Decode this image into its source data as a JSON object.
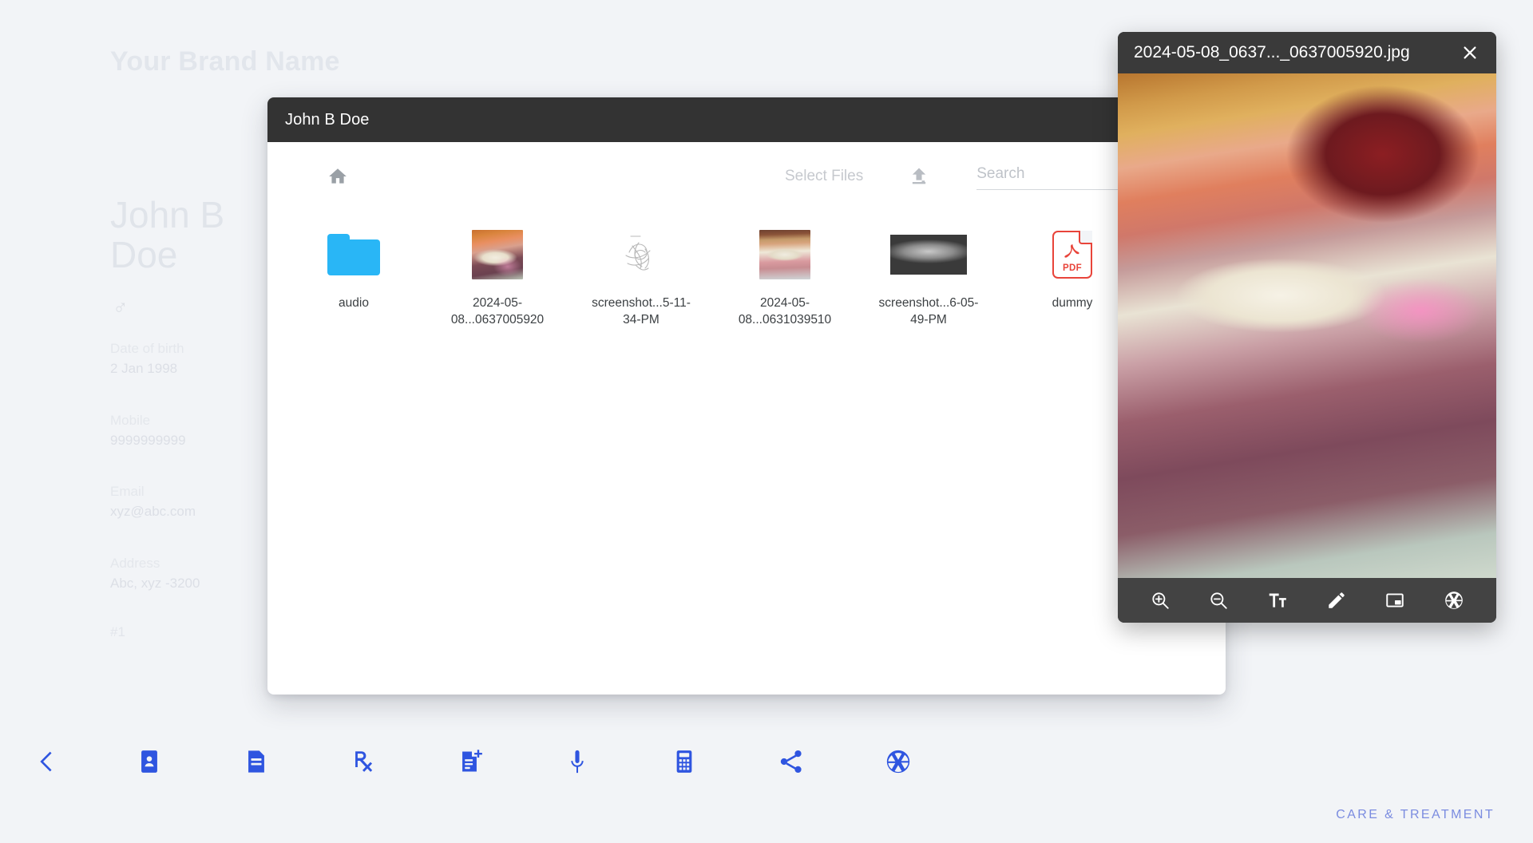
{
  "brand": {
    "name": "Your Brand Name"
  },
  "patient": {
    "name": "John B Doe",
    "gender_icon": "male-symbol",
    "gender_glyph": "♂",
    "dob_label": "Date of birth",
    "dob_value": "2 Jan 1998",
    "mobile_label": "Mobile",
    "mobile_value": "9999999999",
    "email_label": "Email",
    "email_value": "xyz@abc.com",
    "address_label": "Address",
    "address_value": "Abc, xyz -3200",
    "serial": "#1"
  },
  "file_manager": {
    "title": "John B Doe",
    "home_icon": "home-icon",
    "select_files_label": "Select Files",
    "upload_icon": "upload-icon",
    "search": {
      "placeholder": "Search",
      "value": ""
    },
    "files": [
      {
        "name": "audio",
        "type": "folder",
        "icon": "folder-icon"
      },
      {
        "name": "2024-05-08...0637005920",
        "type": "image",
        "icon": "photo-thumbnail"
      },
      {
        "name": "screenshot...5-11-34-PM",
        "type": "image",
        "icon": "sketch-thumbnail"
      },
      {
        "name": "2024-05-08...0631039510",
        "type": "image",
        "icon": "photo-thumbnail"
      },
      {
        "name": "screenshot...6-05-49-PM",
        "type": "image",
        "icon": "xray-thumbnail"
      },
      {
        "name": "dummy",
        "type": "pdf",
        "icon": "pdf-icon",
        "badge": "PDF"
      }
    ]
  },
  "viewer": {
    "title": "2024-05-08_0637..._0637005920.jpg",
    "close_icon": "close-icon",
    "toolbar": [
      {
        "name": "zoom-in-icon",
        "label": "Zoom in"
      },
      {
        "name": "zoom-out-icon",
        "label": "Zoom out"
      },
      {
        "name": "text-format-icon",
        "label": "Text"
      },
      {
        "name": "pencil-icon",
        "label": "Draw"
      },
      {
        "name": "picture-in-picture-icon",
        "label": "Picture in picture"
      },
      {
        "name": "aperture-icon",
        "label": "Camera"
      }
    ]
  },
  "bottom_nav": [
    {
      "name": "back-chevron-icon",
      "label": "Back"
    },
    {
      "name": "contact-folder-icon",
      "label": "Patient profile"
    },
    {
      "name": "notes-folder-icon",
      "label": "Records"
    },
    {
      "name": "prescription-rx-icon",
      "label": "Prescription"
    },
    {
      "name": "note-add-icon",
      "label": "Add note"
    },
    {
      "name": "microphone-icon",
      "label": "Voice note"
    },
    {
      "name": "calculator-icon",
      "label": "Billing"
    },
    {
      "name": "share-icon",
      "label": "Share"
    },
    {
      "name": "aperture-icon",
      "label": "Camera"
    }
  ],
  "footer": {
    "text": "CARE & TREATMENT"
  },
  "colors": {
    "page_background": "#f2f4f7",
    "dialog_titlebar": "#333333",
    "folder_blue": "#29b6f6",
    "nav_blue": "#2f55e0",
    "pdf_red": "#e8443a",
    "footer_blue": "#7b8ce0"
  }
}
